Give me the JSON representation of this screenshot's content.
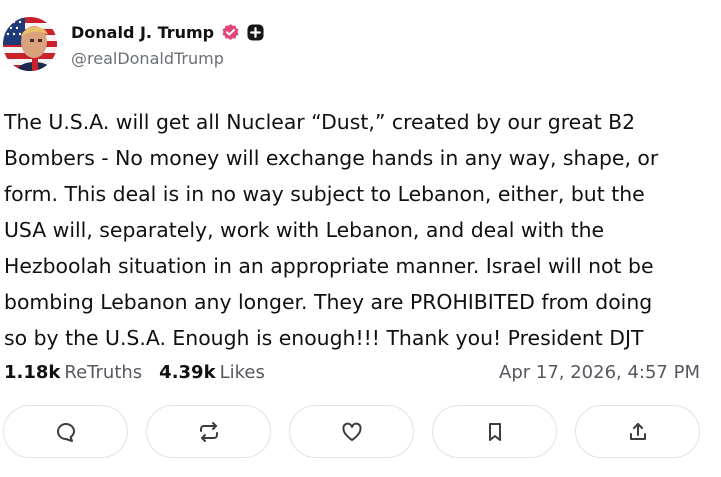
{
  "author": {
    "display_name": "Donald J. Trump",
    "handle": "@realDonaldTrump",
    "avatar_icon": "avatar-flag-portrait"
  },
  "post": {
    "text": "The U.S.A. will get all Nuclear “Dust,” created by our great B2\nBombers - No money will exchange hands in any way, shape, or\nform. This deal is in no way subject to Lebanon, either, but the\nUSA will, separately, work with Lebanon, and deal with the\nHezboolah situation in an appropriate manner. Israel will not be\nbombing Lebanon any longer. They are PROHIBITED from doing\nso by the U.S.A. Enough is enough!!! Thank you! President DJT"
  },
  "stats": {
    "retruths_count": "1.18k",
    "retruths_label": "ReTruths",
    "likes_count": "4.39k",
    "likes_label": "Likes",
    "timestamp": "Apr 17, 2026, 4:57 PM"
  },
  "actions": [
    {
      "icon": "reply-icon"
    },
    {
      "icon": "retruth-icon"
    },
    {
      "icon": "like-icon"
    },
    {
      "icon": "bookmark-icon"
    },
    {
      "icon": "share-icon"
    }
  ],
  "colors": {
    "verified_badge": "#e0457b",
    "text_primary": "#111111",
    "text_secondary": "#6b6f76",
    "button_border": "#e3e3e6"
  }
}
